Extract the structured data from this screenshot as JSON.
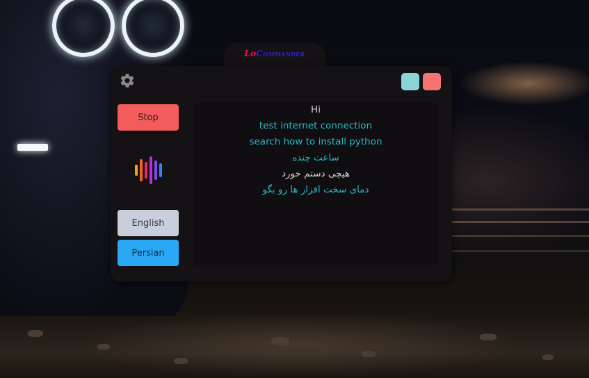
{
  "app": {
    "title_prefix": "Lo",
    "title_rest": "Commander"
  },
  "toolbar": {
    "settings_icon": "gear-icon",
    "minimize_color": "#8ad4d6",
    "close_color": "#f57372"
  },
  "controls": {
    "stop_label": "Stop",
    "english_label": "English",
    "persian_label": "Persian",
    "voice_icon": "voice-waveform-icon",
    "stop_color": "#f25c5c",
    "english_color": "#c9cedc",
    "persian_color": "#2aa8f5"
  },
  "conversation": [
    {
      "speaker": "user",
      "text": "Hi"
    },
    {
      "speaker": "bot",
      "text": "test internet connection"
    },
    {
      "speaker": "bot",
      "text": "search how to install python"
    },
    {
      "speaker": "bot",
      "text": "ساعت چنده"
    },
    {
      "speaker": "user",
      "text": "هیچی دستم خورد"
    },
    {
      "speaker": "bot",
      "text": "دمای سخت افزار ها رو بگو"
    }
  ],
  "colors": {
    "user_text": "#cfcfcf",
    "bot_text": "#2ab7c4",
    "window_bg": "#141215",
    "log_bg": "#100e11"
  }
}
